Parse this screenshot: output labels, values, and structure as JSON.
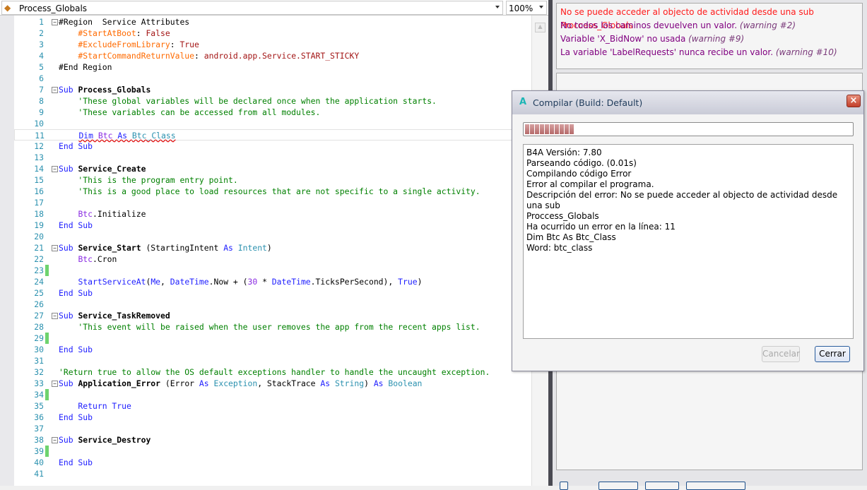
{
  "module_selector": {
    "value": "Process_Globals",
    "icon": "module-icon"
  },
  "zoom": {
    "value": "100%"
  },
  "editor": {
    "current_line": 11,
    "changed_lines": [
      23,
      29,
      34,
      39
    ],
    "lines": [
      {
        "n": "1",
        "fold": true,
        "t": [
          [
            "#Region  Service Attributes",
            "pl"
          ]
        ]
      },
      {
        "n": "2",
        "t": [
          [
            "    #StartAtBoot",
            "at"
          ],
          [
            ": ",
            "pl"
          ],
          [
            "False",
            "vl"
          ]
        ]
      },
      {
        "n": "3",
        "t": [
          [
            "    #ExcludeFromLibrary",
            "at"
          ],
          [
            ": ",
            "pl"
          ],
          [
            "True",
            "vl"
          ]
        ]
      },
      {
        "n": "4",
        "t": [
          [
            "    #StartCommandReturnValue",
            "at"
          ],
          [
            ": ",
            "pl"
          ],
          [
            "android.app.Service.START_STICKY",
            "vl"
          ]
        ]
      },
      {
        "n": "5",
        "t": [
          [
            "#End Region",
            "pl"
          ]
        ]
      },
      {
        "n": "6",
        "t": []
      },
      {
        "n": "7",
        "fold": true,
        "t": [
          [
            "Sub ",
            "kw"
          ],
          [
            "Process_Globals",
            "nm"
          ]
        ]
      },
      {
        "n": "8",
        "t": [
          [
            "    'These global variables will be declared once when the application starts.",
            "cm"
          ]
        ]
      },
      {
        "n": "9",
        "t": [
          [
            "    'These variables can be accessed from all modules.",
            "cm"
          ]
        ]
      },
      {
        "n": "10",
        "t": []
      },
      {
        "n": "11",
        "t": [
          [
            "    ",
            "pl"
          ],
          [
            "Dim ",
            "kw sq"
          ],
          [
            "Btc ",
            "vr sq"
          ],
          [
            "As ",
            "kw sq"
          ],
          [
            "Btc_Class",
            "ty sq"
          ]
        ]
      },
      {
        "n": "12",
        "t": [
          [
            "End Sub",
            "kw"
          ]
        ]
      },
      {
        "n": "13",
        "t": []
      },
      {
        "n": "14",
        "fold": true,
        "t": [
          [
            "Sub ",
            "kw"
          ],
          [
            "Service_Create",
            "nm"
          ]
        ]
      },
      {
        "n": "15",
        "t": [
          [
            "    'This is the program entry point.",
            "cm"
          ]
        ]
      },
      {
        "n": "16",
        "t": [
          [
            "    'This is a good place to load resources that are not specific to a single activity.",
            "cm"
          ]
        ]
      },
      {
        "n": "17",
        "t": []
      },
      {
        "n": "18",
        "t": [
          [
            "    ",
            "pl"
          ],
          [
            "Btc",
            "vr"
          ],
          [
            ".Initialize",
            "pl"
          ]
        ]
      },
      {
        "n": "19",
        "t": [
          [
            "End Sub",
            "kw"
          ]
        ]
      },
      {
        "n": "20",
        "t": []
      },
      {
        "n": "21",
        "fold": true,
        "t": [
          [
            "Sub ",
            "kw"
          ],
          [
            "Service_Start",
            "nm"
          ],
          [
            " (StartingIntent ",
            "pl"
          ],
          [
            "As ",
            "kw"
          ],
          [
            "Intent",
            "ty"
          ],
          [
            ")",
            "pl"
          ]
        ]
      },
      {
        "n": "22",
        "t": [
          [
            "    ",
            "pl"
          ],
          [
            "Btc",
            "vr"
          ],
          [
            ".Cron",
            "pl"
          ]
        ]
      },
      {
        "n": "23",
        "t": []
      },
      {
        "n": "24",
        "t": [
          [
            "    ",
            "pl"
          ],
          [
            "StartServiceAt",
            "kw"
          ],
          [
            "(",
            "pl"
          ],
          [
            "Me",
            "kw"
          ],
          [
            ", ",
            "pl"
          ],
          [
            "DateTime",
            "kw"
          ],
          [
            ".Now + (",
            "pl"
          ],
          [
            "30",
            "vr"
          ],
          [
            " * ",
            "pl"
          ],
          [
            "DateTime",
            "kw"
          ],
          [
            ".TicksPerSecond), ",
            "pl"
          ],
          [
            "True",
            "kw"
          ],
          [
            ")",
            "pl"
          ]
        ]
      },
      {
        "n": "25",
        "t": [
          [
            "End Sub",
            "kw"
          ]
        ]
      },
      {
        "n": "26",
        "t": []
      },
      {
        "n": "27",
        "fold": true,
        "t": [
          [
            "Sub ",
            "kw"
          ],
          [
            "Service_TaskRemoved",
            "nm"
          ]
        ]
      },
      {
        "n": "28",
        "t": [
          [
            "    'This event will be raised when the user removes the app from the recent apps list.",
            "cm"
          ]
        ]
      },
      {
        "n": "29",
        "t": []
      },
      {
        "n": "30",
        "t": [
          [
            "End Sub",
            "kw"
          ]
        ]
      },
      {
        "n": "31",
        "t": []
      },
      {
        "n": "32",
        "t": [
          [
            "'Return true to allow the OS default exceptions handler to handle the uncaught exception.",
            "cm"
          ]
        ]
      },
      {
        "n": "33",
        "fold": true,
        "t": [
          [
            "Sub ",
            "kw"
          ],
          [
            "Application_Error",
            "nm"
          ],
          [
            " (Error ",
            "pl"
          ],
          [
            "As ",
            "kw"
          ],
          [
            "Exception",
            "ty"
          ],
          [
            ", StackTrace ",
            "pl"
          ],
          [
            "As ",
            "kw"
          ],
          [
            "String",
            "ty"
          ],
          [
            ") ",
            "pl"
          ],
          [
            "As ",
            "kw"
          ],
          [
            "Boolean",
            "ty"
          ]
        ]
      },
      {
        "n": "34",
        "t": []
      },
      {
        "n": "35",
        "t": [
          [
            "    Return True",
            "kw"
          ]
        ]
      },
      {
        "n": "36",
        "t": [
          [
            "End Sub",
            "kw"
          ]
        ]
      },
      {
        "n": "37",
        "t": []
      },
      {
        "n": "38",
        "fold": true,
        "t": [
          [
            "Sub ",
            "kw"
          ],
          [
            "Service_Destroy",
            "nm"
          ]
        ]
      },
      {
        "n": "39",
        "t": []
      },
      {
        "n": "40",
        "t": [
          [
            "End Sub",
            "kw"
          ]
        ]
      },
      {
        "n": "41",
        "t": []
      }
    ]
  },
  "messages": {
    "error": "No se puede acceder al objecto de actividad desde una sub Proccess_Globals",
    "warnings": [
      {
        "text": "No todos los caminos devuelven un valor. ",
        "tag": "(warning #2)"
      },
      {
        "text": "Variable 'X_BidNow' no usada ",
        "tag": "(warning #9)"
      },
      {
        "text": "La variable 'LabelRequests' nunca recibe un valor. ",
        "tag": "(warning #10)"
      }
    ]
  },
  "dialog": {
    "icon_letter": "A",
    "title": "Compilar (Build: Default)",
    "progress_segments": 10,
    "output": [
      "B4A Versión: 7.80",
      "Parseando código.    (0.01s)",
      "Compilando código    Error",
      "Error al compilar el programa.",
      "Descripción del error: No se puede acceder al objecto de actividad desde una sub",
      "Proccess_Globals",
      "Ha ocurrido un error en la línea: 11",
      "Dim Btc As Btc_Class",
      "Word: btc_class"
    ],
    "cancel_label": "Cancelar",
    "close_label": "Cerrar",
    "close_icon": "×"
  },
  "colors": {
    "error": "#ff1a1a",
    "warning": "#800080",
    "keyword": "#2020ff",
    "comment": "#008000",
    "attribute": "#ff6a00"
  }
}
